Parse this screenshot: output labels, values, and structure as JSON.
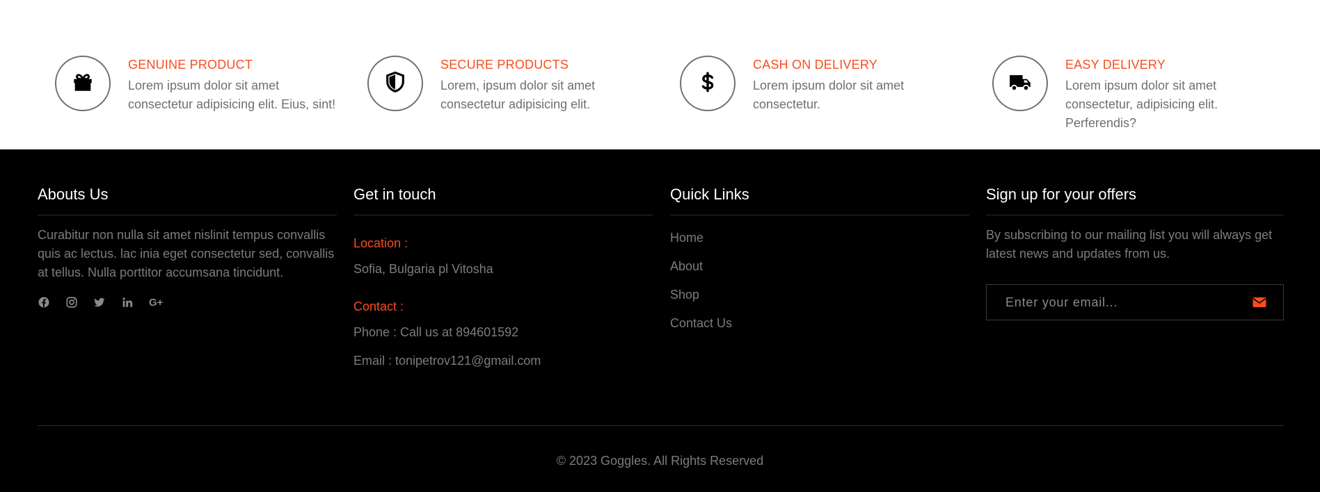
{
  "features": [
    {
      "title": "GENUINE PRODUCT",
      "desc": "Lorem ipsum dolor sit amet consectetur adipisicing elit. Eius, sint!",
      "icon": "gift-icon"
    },
    {
      "title": "SECURE PRODUCTS",
      "desc": "Lorem, ipsum dolor sit amet consectetur adipisicing elit.",
      "icon": "shield-icon"
    },
    {
      "title": "CASH ON DELIVERY",
      "desc": "Lorem ipsum dolor sit amet consectetur.",
      "icon": "dollar-icon"
    },
    {
      "title": "EASY DELIVERY",
      "desc": "Lorem ipsum dolor sit amet consectetur, adipisicing elit. Perferendis?",
      "icon": "truck-icon"
    }
  ],
  "footer": {
    "about": {
      "title": "Abouts Us",
      "text": "Curabitur non nulla sit amet nislinit tempus convallis quis ac lectus. lac inia eget consectetur sed, convallis at tellus. Nulla porttitor accumsana tincidunt.",
      "socials": [
        "facebook-icon",
        "instagram-icon",
        "twitter-icon",
        "linkedin-icon",
        "google-plus-icon"
      ],
      "gplus_label": "G+"
    },
    "contact": {
      "title": "Get in touch",
      "location_label": "Location :",
      "location": "Sofia, Bulgaria pl Vitosha",
      "contact_label": "Contact :",
      "phone": "Phone : Call us at 894601592",
      "email": "Email : tonipetrov121@gmail.com"
    },
    "links": {
      "title": "Quick Links",
      "items": [
        "Home",
        "About",
        "Shop",
        "Contact Us"
      ]
    },
    "signup": {
      "title": "Sign up for your offers",
      "text": "By subscribing to our mailing list you will always get latest news and updates from us.",
      "placeholder": "Enter your email..."
    },
    "copyright": "© 2023 Goggles. All Rights Reserved"
  },
  "colors": {
    "accent": "#fa4c1e",
    "footer_bg": "#000000",
    "muted_text": "#7c7c7c"
  }
}
